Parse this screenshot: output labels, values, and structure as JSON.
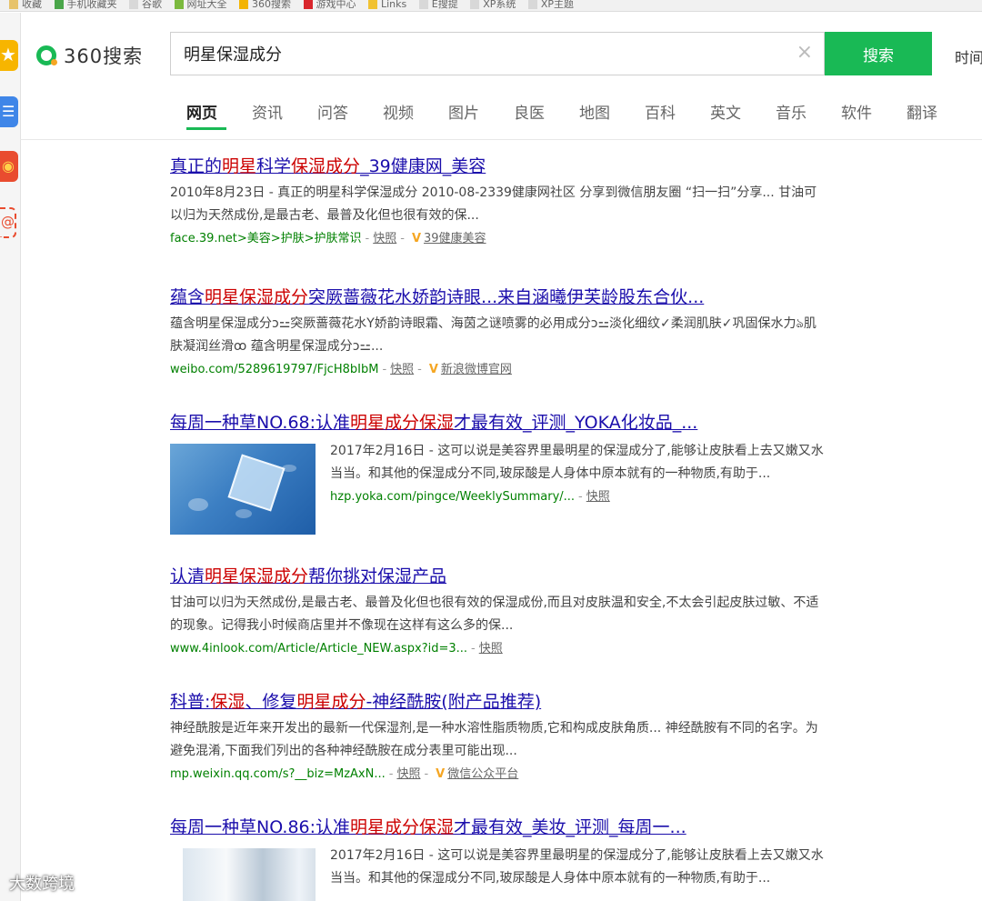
{
  "bookmarks": [
    {
      "label": "收藏"
    },
    {
      "label": "手机收藏夹"
    },
    {
      "label": "谷歌"
    },
    {
      "label": "网址大全"
    },
    {
      "label": "360搜索"
    },
    {
      "label": "游戏中心"
    },
    {
      "label": "Links"
    },
    {
      "label": "E搜提"
    },
    {
      "label": "XP系统"
    },
    {
      "label": "XP主题"
    }
  ],
  "header": {
    "logo_text": "360搜索",
    "search_value": "明星保湿成分",
    "search_button": "搜索",
    "time_link": "时间",
    "clear_icon": "×"
  },
  "tabs": [
    {
      "label": "网页",
      "active": true
    },
    {
      "label": "资讯"
    },
    {
      "label": "问答"
    },
    {
      "label": "视频"
    },
    {
      "label": "图片"
    },
    {
      "label": "良医"
    },
    {
      "label": "地图"
    },
    {
      "label": "百科"
    },
    {
      "label": "英文"
    },
    {
      "label": "音乐"
    },
    {
      "label": "软件"
    },
    {
      "label": "翻译"
    }
  ],
  "results": [
    {
      "title_parts": [
        "真正的",
        "明星",
        "科学",
        "保湿成分",
        "_39健康网_美容"
      ],
      "desc": "2010年8月23日 - 真正的明星科学保湿成分 2010-08-2339健康网社区 分享到微信朋友圈 “扫一扫”分享... 甘油可以归为天然成份,是最古老、最普及化但也很有效的保...",
      "url": "face.39.net>美容>护肤>护肤常识",
      "snapshot": "快照",
      "source": "39健康美容"
    },
    {
      "title_parts": [
        "蕴含",
        "明星保湿成分",
        "突厥蔷薇花水娇韵诗眼...来自涵曦伊芙龄股东合伙..."
      ],
      "desc": "蕴含明星保湿成分ↄ⚍突厥蔷薇花水Y娇韵诗眼霜、海茵之谜喷雾的必用成分ↄ⚍淡化细纹✓柔润肌肤✓巩固保水力ঌ肌肤凝润丝滑ꝏ 蕴含明星保湿成分ↄ⚍...",
      "url": "weibo.com/5289619797/FjcH8bIbM",
      "snapshot": "快照",
      "source": "新浪微博官网"
    },
    {
      "title_parts": [
        "每周一种草NO.68:认准",
        "明星成分保湿",
        "才最有效_评测_YOKA化妆品_..."
      ],
      "desc": "2017年2月16日 - 这可以说是美容界里最明星的保湿成分了,能够让皮肤看上去又嫩又水当当。和其他的保湿成分不同,玻尿酸是人身体中原本就有的一种物质,有助于...",
      "url": "hzp.yoka.com/pingce/WeeklySummary/...",
      "snapshot": "快照"
    },
    {
      "title_parts": [
        "认清",
        "明星保湿成分",
        "帮你挑对保湿产品"
      ],
      "desc": "甘油可以归为天然成份,是最古老、最普及化但也很有效的保湿成份,而且对皮肤温和安全,不太会引起皮肤过敏、不适的现象。记得我小时候商店里并不像现在这样有这么多的保...",
      "url": "www.4inlook.com/Article/Article_NEW.aspx?id=3...",
      "snapshot": "快照"
    },
    {
      "title_parts": [
        "科普:",
        "保湿",
        "、修复",
        "明星成分",
        "-神经酰胺(附产品推荐)"
      ],
      "desc": "神经酰胺是近年来开发出的最新一代保湿剂,是一种水溶性脂质物质,它和构成皮肤角质... 神经酰胺有不同的名字。为避免混淆,下面我们列出的各种神经酰胺在成分表里可能出现...",
      "url": "mp.weixin.qq.com/s?__biz=MzAxN...",
      "snapshot": "快照",
      "source": "微信公众平台"
    },
    {
      "title_parts": [
        "每周一种草NO.86:认准",
        "明星成分保湿",
        "才最有效_美妆_评测_每周一..."
      ],
      "desc": "2017年2月16日 - 这可以说是美容界里最明星的保湿成分了,能够让皮肤看上去又嫩又水当当。和其他的保湿成分不同,玻尿酸是人身体中原本就有的一种物质,有助于..."
    }
  ],
  "watermark": "大数跨境"
}
